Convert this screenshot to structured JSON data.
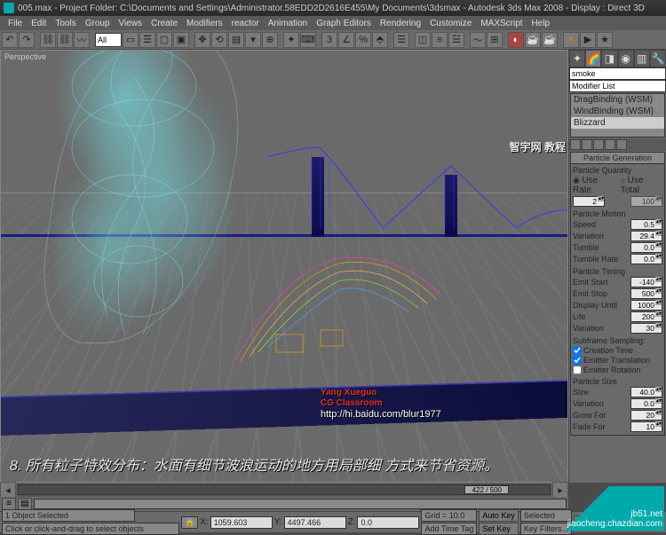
{
  "title": "005.max - Project Folder: C:\\Documents and Settings\\Administrator.58EDD2D2616E455\\My Documents\\3dsmax - Autodesk 3ds Max 2008 - Display : Direct 3D",
  "menu": [
    "File",
    "Edit",
    "Tools",
    "Group",
    "Views",
    "Create",
    "Modifiers",
    "reactor",
    "Animation",
    "Graph Editors",
    "Rendering",
    "Customize",
    "MAXScript",
    "Help"
  ],
  "toolbar_input": "All",
  "viewport": {
    "label": "Perspective"
  },
  "watermark": {
    "line1": "Yang Xueguo",
    "line2": "CG Classroom",
    "url": "http://hi.baidu.com/blur1977",
    "top": "智宇网 教程",
    "corner1": "jb51.net",
    "corner2": "jiaocheng.chazdian.com"
  },
  "caption": "8. 所有粒子特效分布：水面有细节波浪运动的地方用局部细\n方式来节省资源。",
  "object_name": "smoke",
  "modifier_dd": "Modifier List",
  "modifiers": [
    "DragBinding (WSM)",
    "WindBinding (WSM)",
    "Blizzard"
  ],
  "rollout_title": "Particle Generation",
  "sections": {
    "quantity": {
      "title": "Particle Quantity",
      "use_rate": "Use Rate",
      "use_total": "Use Total",
      "rate": "2",
      "total": "100"
    },
    "motion": {
      "title": "Particle Motion",
      "speed": {
        "l": "Speed",
        "v": "0.5"
      },
      "variation": {
        "l": "Variation",
        "v": "29.4"
      },
      "tumble": {
        "l": "Tumble",
        "v": "0.0"
      },
      "tumble_rate": {
        "l": "Tumble Rate",
        "v": "0.0"
      }
    },
    "timing": {
      "title": "Particle Timing",
      "emit_start": {
        "l": "Emit Start",
        "v": "-140"
      },
      "emit_stop": {
        "l": "Emit Stop",
        "v": "500"
      },
      "display_until": {
        "l": "Display Until",
        "v": "1000"
      },
      "life": {
        "l": "Life",
        "v": "200"
      },
      "variation": {
        "l": "Variation",
        "v": "30"
      }
    },
    "subframe": {
      "title": "Subframe Sampling:",
      "creation": "Creation Time",
      "translation": "Emitter Translation",
      "rotation": "Emitter Rotation"
    },
    "size": {
      "title": "Particle Size",
      "size": {
        "l": "Size",
        "v": "40.0"
      },
      "variation": {
        "l": "Variation",
        "v": "0.0"
      },
      "grow": {
        "l": "Grow For",
        "v": "20"
      },
      "fade": {
        "l": "Fade For",
        "v": "10"
      }
    }
  },
  "timeline": {
    "frame": "422 / 500"
  },
  "status": {
    "selected": "1 Object Selected",
    "prompt": "Click or click-and-drag to select objects",
    "x": "1059.603",
    "y": "4497.466",
    "z": "0.0",
    "grid": "Grid = 10.0",
    "add_time_tag": "Add Time Tag",
    "auto_key": "Auto Key",
    "set_key": "Set Key",
    "selected_btn": "Selected",
    "key_filters": "Key Filters..."
  }
}
